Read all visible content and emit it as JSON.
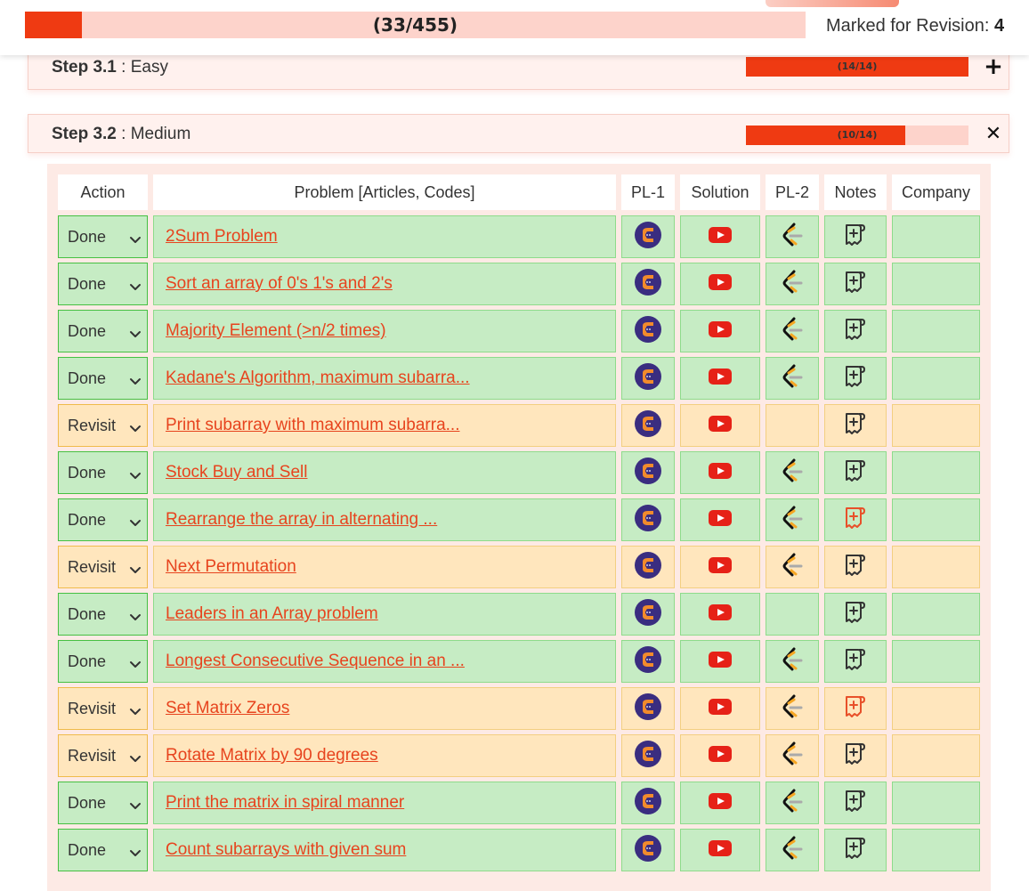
{
  "header": {
    "overall_progress_label": "(33/455)",
    "overall_done": 33,
    "overall_total": 455,
    "revision_label": "Marked for Revision:",
    "revision_count": "4"
  },
  "steps": [
    {
      "number": "Step 3.1",
      "separator": " : ",
      "name": "Easy",
      "progress_label": "(14/14)",
      "done": 14,
      "total": 14,
      "toggle": "+"
    },
    {
      "number": "Step 3.2",
      "separator": " : ",
      "name": "Medium",
      "progress_label": "(10/14)",
      "done": 10,
      "total": 14,
      "toggle": "✕"
    }
  ],
  "table": {
    "columns": [
      "Action",
      "Problem [Articles, Codes]",
      "PL-1",
      "Solution",
      "PL-2",
      "Notes",
      "Company"
    ],
    "rows": [
      {
        "action": "Done",
        "problem": "2Sum Problem",
        "pl2": true,
        "note_highlight": false
      },
      {
        "action": "Done",
        "problem": "Sort an array of 0's 1's and 2's",
        "pl2": true,
        "note_highlight": false
      },
      {
        "action": "Done",
        "problem": "Majority Element (>n/2 times)",
        "pl2": true,
        "note_highlight": false
      },
      {
        "action": "Done",
        "problem": "Kadane's Algorithm, maximum subarra...",
        "pl2": true,
        "note_highlight": false
      },
      {
        "action": "Revisit",
        "problem": "Print subarray with maximum subarra...",
        "pl2": false,
        "note_highlight": false
      },
      {
        "action": "Done",
        "problem": "Stock Buy and Sell",
        "pl2": true,
        "note_highlight": false
      },
      {
        "action": "Done",
        "problem": "Rearrange the array in alternating ...",
        "pl2": true,
        "note_highlight": true
      },
      {
        "action": "Revisit",
        "problem": "Next Permutation",
        "pl2": true,
        "note_highlight": false
      },
      {
        "action": "Done",
        "problem": "Leaders in an Array problem",
        "pl2": false,
        "note_highlight": false
      },
      {
        "action": "Done",
        "problem": "Longest Consecutive Sequence in an ...",
        "pl2": true,
        "note_highlight": false
      },
      {
        "action": "Revisit",
        "problem": "Set Matrix Zeros",
        "pl2": true,
        "note_highlight": true
      },
      {
        "action": "Revisit",
        "problem": "Rotate Matrix by 90 degrees",
        "pl2": true,
        "note_highlight": false
      },
      {
        "action": "Done",
        "problem": "Print the matrix in spiral manner",
        "pl2": true,
        "note_highlight": false
      },
      {
        "action": "Done",
        "problem": "Count subarrays with given sum",
        "pl2": true,
        "note_highlight": false
      }
    ]
  },
  "icons": {
    "pl1": "coding-ninjas-icon",
    "solution": "youtube-icon",
    "pl2": "leetcode-icon",
    "notes": "add-note-icon",
    "dropdown": "chevron-down-icon"
  },
  "colors": {
    "accent": "#ef3a12",
    "progress_track": "#fdd3cb",
    "done_bg": "#c6ecc4",
    "revisit_bg": "#ffe6bd",
    "link": "#e7441e",
    "note_highlight": "#e8502a"
  }
}
